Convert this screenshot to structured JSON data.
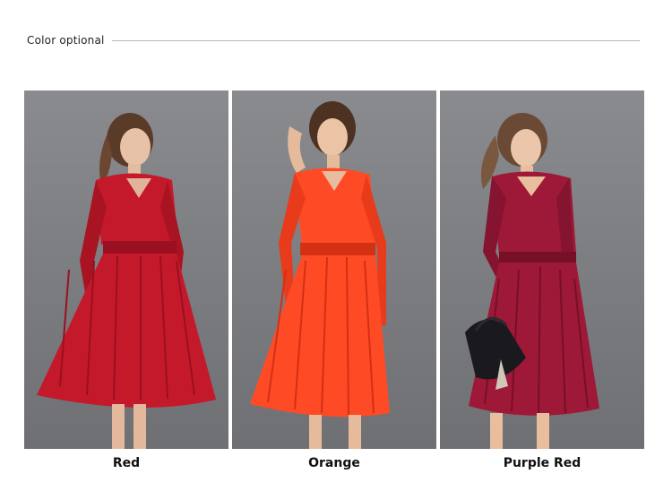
{
  "header": {
    "title": "Color optional"
  },
  "variants": [
    {
      "name": "Red",
      "color": "#c4192b",
      "shade": "#9a1020"
    },
    {
      "name": "Orange",
      "color": "#ff4a26",
      "shade": "#d33014"
    },
    {
      "name": "Purple Red",
      "color": "#9e1838",
      "shade": "#761026"
    }
  ]
}
